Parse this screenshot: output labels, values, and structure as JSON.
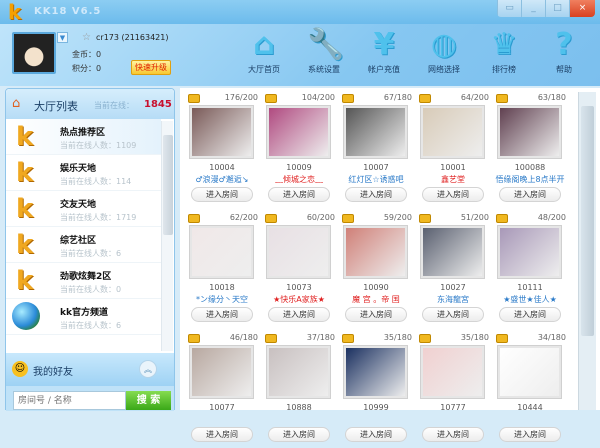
{
  "app": {
    "title": "KK18 V6.5"
  },
  "window_controls": [
    "▭",
    "_",
    "□",
    "×"
  ],
  "user": {
    "name": "cr173 (21163421)",
    "coins_label": "金币：0",
    "points_label": "积分：0",
    "upgrade": "快速升级"
  },
  "toolbar": [
    {
      "label": "大厅首页",
      "icon": "home-icon",
      "glyph": "⌂"
    },
    {
      "label": "系统设置",
      "icon": "wrench-icon",
      "glyph": "🔧"
    },
    {
      "label": "帐户充值",
      "icon": "money-bag-icon",
      "glyph": "¥"
    },
    {
      "label": "网络选择",
      "icon": "globe-icon",
      "glyph": "◍"
    },
    {
      "label": "排行榜",
      "icon": "crown-icon",
      "glyph": "♛"
    },
    {
      "label": "帮助",
      "icon": "help-icon",
      "glyph": "?"
    }
  ],
  "hall": {
    "title": "大厅列表",
    "online_label": "当前在线：",
    "online": "1845",
    "items": [
      {
        "name": "热点推荐区",
        "count": "当前在线人数：1109"
      },
      {
        "name": "娱乐天地",
        "count": "当前在线人数：114"
      },
      {
        "name": "交友天地",
        "count": "当前在线人数：1719"
      },
      {
        "name": "综艺社区",
        "count": "当前在线人数：6"
      },
      {
        "name": "劲歌炫舞2区",
        "count": "当前在线人数：0"
      },
      {
        "name": "kk官方频道",
        "count": "当前在线人数：6"
      }
    ]
  },
  "friends": {
    "title": "我的好友"
  },
  "search": {
    "placeholder": "房间号 / 名称",
    "button": "搜 索"
  },
  "enter_label": "进入房间",
  "rooms": [
    {
      "count": "176/200",
      "id": "10004",
      "name": "♂浪漫♂邂逅↘",
      "color": "#2a7ac8",
      "thumb": "#7a5a58"
    },
    {
      "count": "104/200",
      "id": "10009",
      "name": "﹏倾城之恋﹏",
      "color": "#e02020",
      "thumb": "#b04a80"
    },
    {
      "count": "67/180",
      "id": "10007",
      "name": "红灯区☆诱惑吧",
      "color": "#2a7ac8",
      "thumb": "#555"
    },
    {
      "count": "64/200",
      "id": "10001",
      "name": "鑫艺堂",
      "color": "#e02020",
      "thumb": "#d8cbb8"
    },
    {
      "count": "63/180",
      "id": "100088",
      "name": "悟缘阁晚上8点半开",
      "color": "#2a7ac8",
      "thumb": "#604050"
    },
    {
      "count": "62/200",
      "id": "10018",
      "name": "*ン缘分丶天空",
      "color": "#2a7ac8",
      "thumb": "#f0e8e8"
    },
    {
      "count": "60/200",
      "id": "10073",
      "name": "★快乐A家族★",
      "color": "#e02020",
      "thumb": "#e8e0e4"
    },
    {
      "count": "59/200",
      "id": "10090",
      "name": "魔 宫 。帝 国",
      "color": "#e02020",
      "thumb": "#d08078"
    },
    {
      "count": "51/200",
      "id": "10027",
      "name": "东海龍宮",
      "color": "#2a7ac8",
      "thumb": "#5a6070"
    },
    {
      "count": "48/200",
      "id": "10111",
      "name": "★盛世★佳人★",
      "color": "#2a7ac8",
      "thumb": "#a898b8"
    },
    {
      "count": "46/180",
      "id": "10077",
      "name": "",
      "color": "#2a7ac8",
      "thumb": "#b8a8a0"
    },
    {
      "count": "37/180",
      "id": "10888",
      "name": "",
      "color": "#2a7ac8",
      "thumb": "#c8c0c0"
    },
    {
      "count": "35/180",
      "id": "10999",
      "name": "",
      "color": "#2a7ac8",
      "thumb": "#1a3060"
    },
    {
      "count": "35/180",
      "id": "10777",
      "name": "",
      "color": "#2a7ac8",
      "thumb": "#f0d0d0"
    },
    {
      "count": "34/180",
      "id": "10444",
      "name": "",
      "color": "#2a7ac8",
      "thumb": "#ffffff"
    }
  ]
}
